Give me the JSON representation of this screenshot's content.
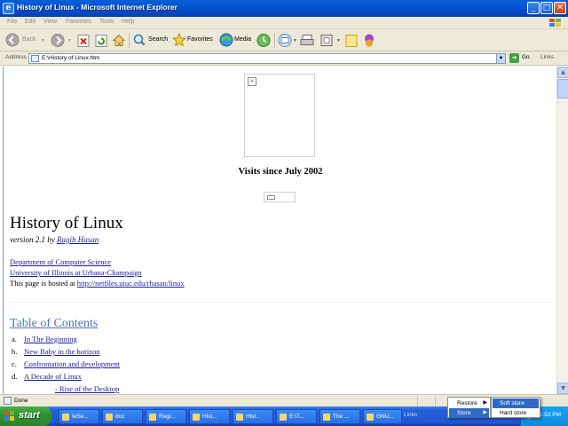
{
  "window": {
    "title": "History of Linux - Microsoft Internet Explorer"
  },
  "menubar": {
    "items": [
      "File",
      "Edit",
      "View",
      "Favorites",
      "Tools",
      "Help"
    ]
  },
  "toolbar": {
    "back_label": "Back",
    "search_label": "Search",
    "favorites_label": "Favorites",
    "media_label": "Media"
  },
  "address": {
    "label": "Address",
    "value": "E:\\History of Linux.htm",
    "go_label": "Go",
    "links_label": "Links"
  },
  "page": {
    "visits_heading": "Visits since July 2002",
    "title": "History of Linux",
    "version_prefix": "version 2.1 by ",
    "author": "Ragib Hasan",
    "dept_link": "Department of Computer Science",
    "univ_link": "University of Illinois at Urbana-Champaign",
    "hosted_prefix": "This page is hosted at ",
    "hosted_url": "http://netfiles.uiuc.edu/rhasan/linux",
    "toc_heading": "Table of Contents",
    "toc": [
      {
        "marker": "a.",
        "label": "In The Beginning"
      },
      {
        "marker": "b.",
        "label": "New Baby in the horizon"
      },
      {
        "marker": "c.",
        "label": "Confrontation and development"
      },
      {
        "marker": "d.",
        "label": "A Decade of Linux"
      }
    ],
    "subitem": "- Rise of the Desktop"
  },
  "statusbar": {
    "text": "Done"
  },
  "taskbar": {
    "start_label": "start",
    "tasks": [
      "IeSe...",
      "doc",
      "Regi...",
      "Hist...",
      "Hist...",
      "E:\\T...",
      "The ...",
      "GNU..."
    ],
    "links_label": "Links",
    "clock": "1:53 PM"
  },
  "context_menu": {
    "items": [
      "Restore",
      "Store"
    ],
    "submenu": [
      "Soft store",
      "Hard store"
    ]
  },
  "colors": {
    "titlebar": "#0454d0",
    "link": "#1a1aa6",
    "toc_heading": "#4a77b8",
    "menu_highlight": "#316ac5"
  }
}
